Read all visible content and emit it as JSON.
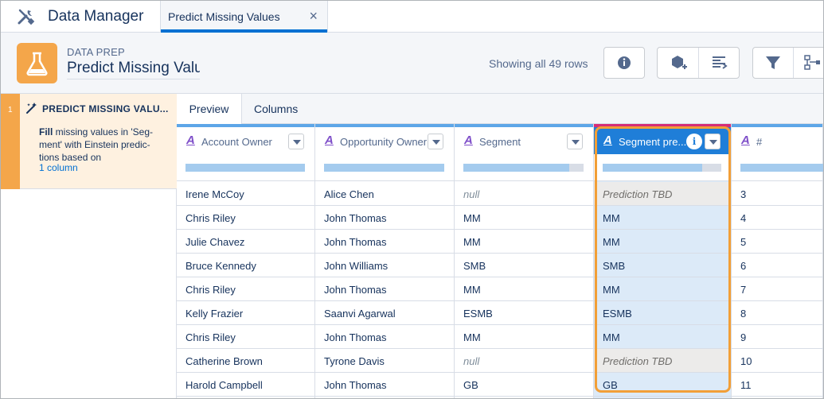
{
  "app": {
    "title": "Data Manager",
    "tools_icon": "tools-icon"
  },
  "tab": {
    "label": "Predict Missing Values",
    "close": "×"
  },
  "header": {
    "eyebrow": "DATA PREP",
    "name": "Predict Missing Valu",
    "rows_text": "Showing all 49 rows",
    "flask_icon": "flask-icon",
    "accent": "#f4a64a"
  },
  "toolbar": {
    "info_icon": "info-icon",
    "add_node_icon": "add-node-icon",
    "transform_icon": "transform-icon",
    "filter_icon": "filter-icon",
    "flow_icon": "flow-icon"
  },
  "step": {
    "number": "1",
    "title": "PREDICT MISSING VALU...",
    "desc_bold": "Fill",
    "desc_rest": " missing values in 'Seg-ment' with Einstein predic-tions based on",
    "link": "1 column"
  },
  "content_tabs": {
    "preview": "Preview",
    "columns": "Columns"
  },
  "columns": [
    {
      "type_glyph": "A",
      "label": "Account Owner",
      "quality": 1.0
    },
    {
      "type_glyph": "A",
      "label": "Opportunity Owner",
      "quality": 1.0
    },
    {
      "type_glyph": "A",
      "label": "Segment",
      "quality": 0.88
    },
    {
      "type_glyph": "A",
      "label": "Segment pre...",
      "quality": 0.84,
      "selected": true
    },
    {
      "type_glyph": "A",
      "label": "#",
      "quality": 1.0
    }
  ],
  "rows": [
    [
      "Irene McCoy",
      "Alice Chen",
      "null",
      "Prediction TBD",
      "3"
    ],
    [
      "Chris Riley",
      "John Thomas",
      "MM",
      "MM",
      "4"
    ],
    [
      "Julie Chavez",
      "John Thomas",
      "MM",
      "MM",
      "5"
    ],
    [
      "Bruce Kennedy",
      "John Williams",
      "SMB",
      "SMB",
      "6"
    ],
    [
      "Chris Riley",
      "John Thomas",
      "MM",
      "MM",
      "7"
    ],
    [
      "Kelly Frazier",
      "Saanvi Agarwal",
      "ESMB",
      "ESMB",
      "8"
    ],
    [
      "Chris Riley",
      "John Thomas",
      "MM",
      "MM",
      "9"
    ],
    [
      "Catherine Brown",
      "Tyrone Davis",
      "null",
      "Prediction TBD",
      "10"
    ],
    [
      "Harold Campbell",
      "John Thomas",
      "GB",
      "GB",
      "11"
    ]
  ]
}
